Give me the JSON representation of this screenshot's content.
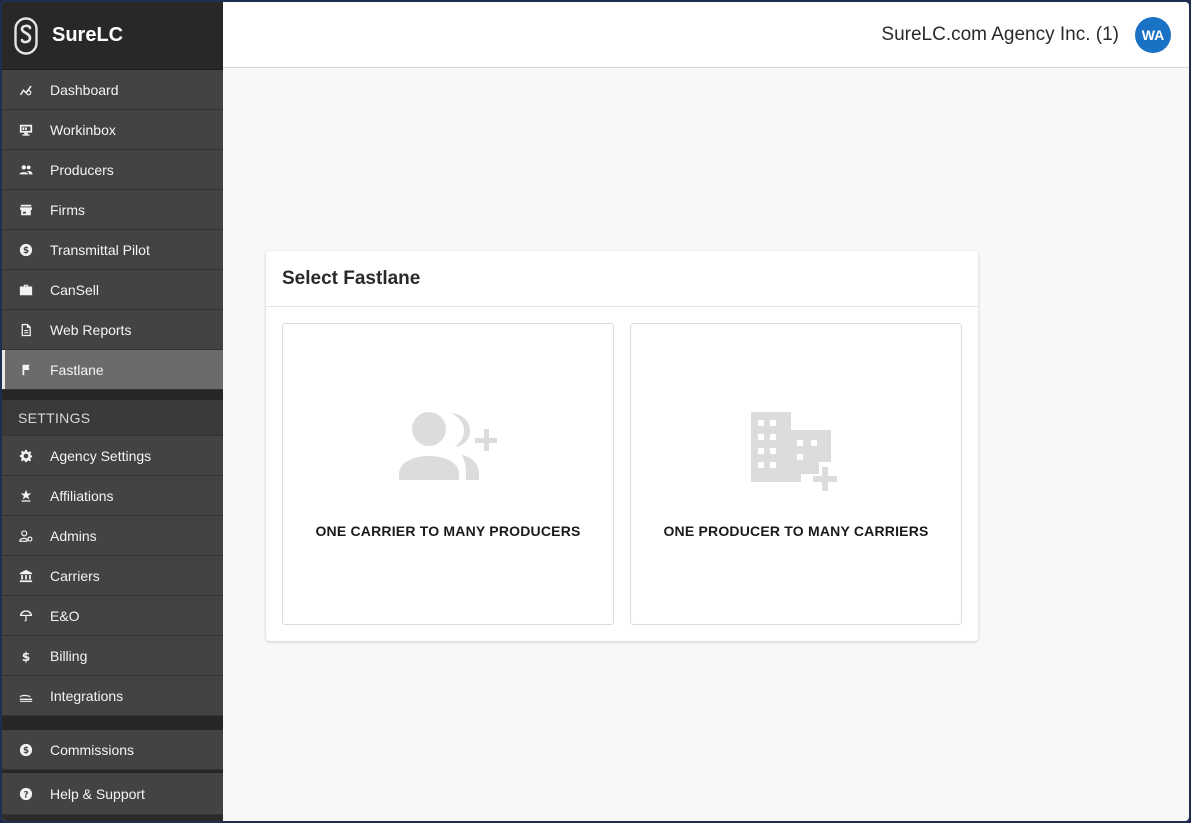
{
  "brand": {
    "name": "SureLC"
  },
  "sidebar": {
    "items": [
      {
        "label": "Dashboard",
        "icon": "chart-line-icon"
      },
      {
        "label": "Workinbox",
        "icon": "monitor-icon"
      },
      {
        "label": "Producers",
        "icon": "people-icon"
      },
      {
        "label": "Firms",
        "icon": "store-icon"
      },
      {
        "label": "Transmittal Pilot",
        "icon": "dollar-circle-icon"
      },
      {
        "label": "CanSell",
        "icon": "briefcase-icon"
      },
      {
        "label": "Web Reports",
        "icon": "document-icon"
      },
      {
        "label": "Fastlane",
        "icon": "flag-icon",
        "active": true
      }
    ],
    "settings_header": "SETTINGS",
    "settings_items": [
      {
        "label": "Agency Settings",
        "icon": "gear-icon"
      },
      {
        "label": "Affiliations",
        "icon": "star-person-icon"
      },
      {
        "label": "Admins",
        "icon": "person-gear-icon"
      },
      {
        "label": "Carriers",
        "icon": "bank-icon"
      },
      {
        "label": "E&O",
        "icon": "umbrella-icon"
      },
      {
        "label": "Billing",
        "icon": "dollar-icon"
      },
      {
        "label": "Integrations",
        "icon": "integration-icon"
      }
    ],
    "bottom_items": [
      {
        "label": "Commissions",
        "icon": "dollar-circle-icon"
      },
      {
        "label": "Help & Support",
        "icon": "help-icon"
      }
    ]
  },
  "header": {
    "agency_name": "SureLC.com Agency Inc. (1)",
    "avatar_initials": "WA",
    "avatar_color": "#1a72c4"
  },
  "card": {
    "title": "Select Fastlane",
    "options": [
      {
        "label": "ONE CARRIER TO MANY PRODUCERS",
        "icon": "person-add-icon"
      },
      {
        "label": "ONE PRODUCER TO MANY CARRIERS",
        "icon": "building-add-icon"
      }
    ]
  }
}
